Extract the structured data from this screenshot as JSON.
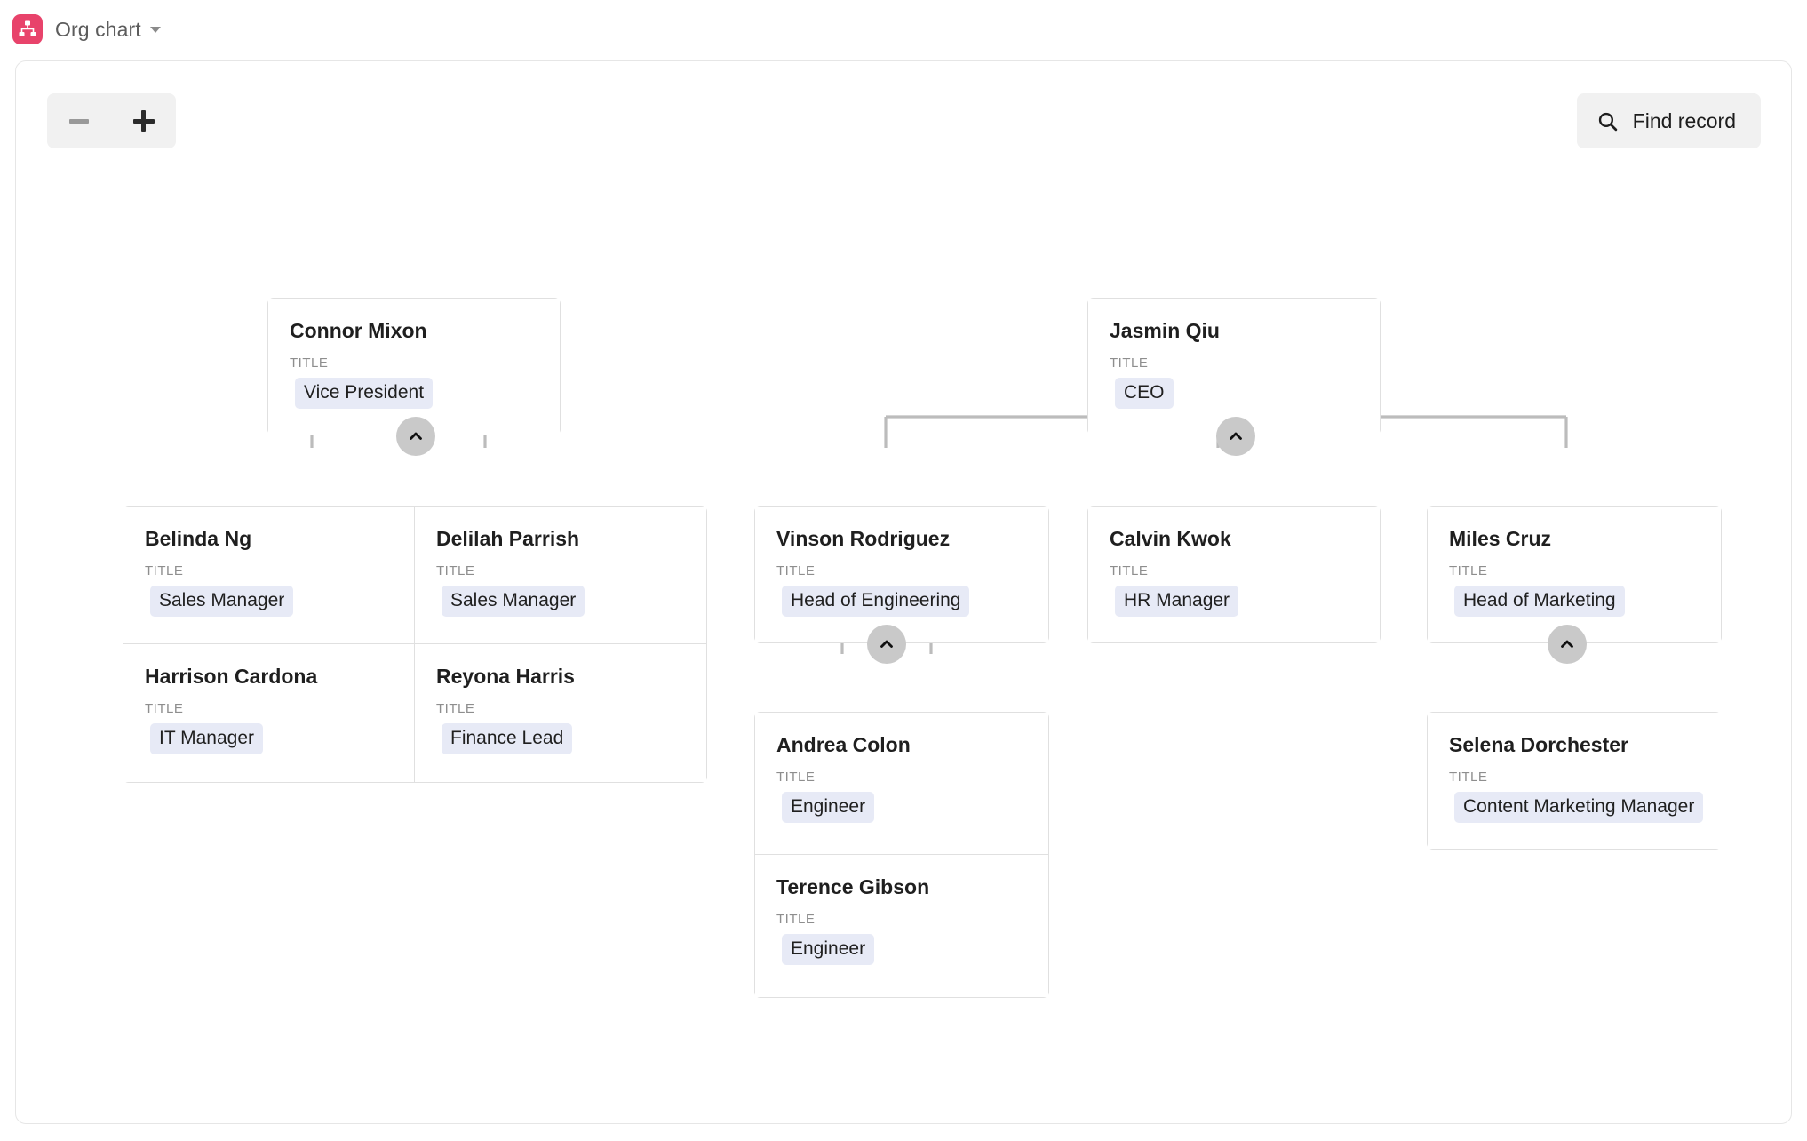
{
  "header": {
    "app_icon": "org-chart-icon",
    "title": "Org chart",
    "caret": "chevron-down-icon"
  },
  "toolbar": {
    "zoom_out_label": "−",
    "zoom_in_label": "+",
    "zoom_out_icon": "minus-icon",
    "zoom_in_icon": "plus-icon",
    "find_record_label": "Find record",
    "find_record_icon": "search-icon"
  },
  "field_label": "TITLE",
  "colors": {
    "brand": "#e8436b",
    "pill_bg": "#e7eaf6",
    "toggle_bg": "#c9c9c9",
    "connector": "#bcbcbc",
    "card_border": "#e0e0e0",
    "toolbar_bg": "#f1f1f1"
  },
  "chart_data": {
    "type": "org-chart",
    "title": "Org chart",
    "field_label": "TITLE",
    "roots": [
      "connor_mixon",
      "jasmin_qiu"
    ],
    "nodes": [
      {
        "id": "connor_mixon",
        "name": "Connor Mixon",
        "title": "Vice President",
        "parent": null,
        "expanded": true,
        "toggle": "chevron-up-icon"
      },
      {
        "id": "belinda_ng",
        "name": "Belinda Ng",
        "title": "Sales Manager",
        "parent": "connor_mixon",
        "expanded": false,
        "toggle": null
      },
      {
        "id": "delilah_parrish",
        "name": "Delilah Parrish",
        "title": "Sales Manager",
        "parent": "connor_mixon",
        "expanded": false,
        "toggle": null
      },
      {
        "id": "harrison_cardona",
        "name": "Harrison Cardona",
        "title": "IT Manager",
        "parent": "connor_mixon",
        "expanded": false,
        "toggle": null
      },
      {
        "id": "reyona_harris",
        "name": "Reyona Harris",
        "title": "Finance Lead",
        "parent": "connor_mixon",
        "expanded": false,
        "toggle": null
      },
      {
        "id": "jasmin_qiu",
        "name": "Jasmin Qiu",
        "title": "CEO",
        "parent": null,
        "expanded": true,
        "toggle": "chevron-up-icon"
      },
      {
        "id": "vinson_rodriguez",
        "name": "Vinson Rodriguez",
        "title": "Head of Engineering",
        "parent": "jasmin_qiu",
        "expanded": true,
        "toggle": "chevron-up-icon"
      },
      {
        "id": "calvin_kwok",
        "name": "Calvin Kwok",
        "title": "HR Manager",
        "parent": "jasmin_qiu",
        "expanded": false,
        "toggle": null
      },
      {
        "id": "miles_cruz",
        "name": "Miles Cruz",
        "title": "Head of Marketing",
        "parent": "jasmin_qiu",
        "expanded": true,
        "toggle": "chevron-up-icon"
      },
      {
        "id": "andrea_colon",
        "name": "Andrea Colon",
        "title": "Engineer",
        "parent": "vinson_rodriguez",
        "expanded": false,
        "toggle": null
      },
      {
        "id": "terence_gibson",
        "name": "Terence Gibson",
        "title": "Engineer",
        "parent": "vinson_rodriguez",
        "expanded": false,
        "toggle": null
      },
      {
        "id": "selena_dorchester",
        "name": "Selena Dorchester",
        "title": "Content Marketing Manager",
        "parent": "miles_cruz",
        "expanded": false,
        "toggle": null
      }
    ]
  }
}
